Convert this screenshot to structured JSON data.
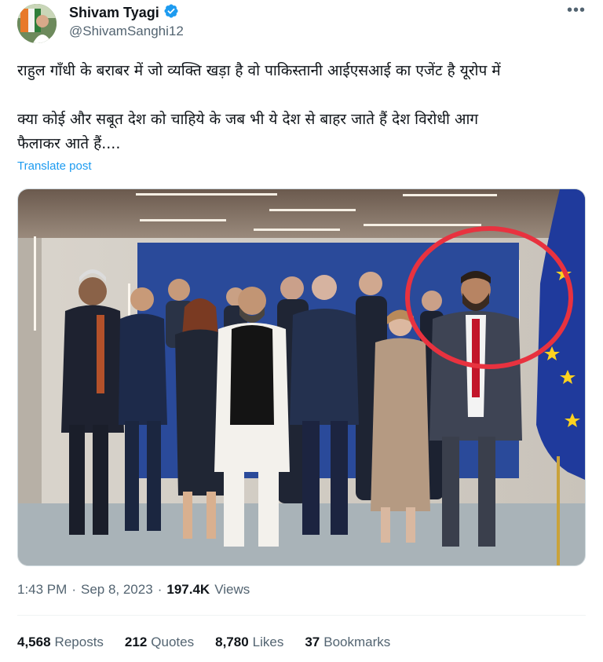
{
  "author": {
    "display_name": "Shivam Tyagi",
    "handle": "@ShivamSanghi12",
    "verified_icon": "verified-badge-icon"
  },
  "post": {
    "line1": "राहुल गाँधी के बराबर में जो व्यक्ति खड़ा है वो पाकिस्तानी आईएसआई का एजेंट है यूरोप में",
    "line2": "क्या कोई और सबूत देश को चाहिये के जब भी ये देश से बाहर जाते हैं देश विरोधी आग",
    "line3": "फैलाकर आते हैं....",
    "translate_label": "Translate post"
  },
  "meta": {
    "time": "1:43 PM",
    "sep1": "·",
    "date": "Sep 8, 2023",
    "sep2": "·",
    "views_count": "197.4K",
    "views_label": "Views"
  },
  "stats": {
    "reposts_count": "4,568",
    "reposts_label": "Reposts",
    "quotes_count": "212",
    "quotes_label": "Quotes",
    "likes_count": "8,780",
    "likes_label": "Likes",
    "bookmarks_count": "37",
    "bookmarks_label": "Bookmarks"
  },
  "colors": {
    "link": "#1d9bf0",
    "secondary_text": "#536471",
    "highlight_circle": "#e8323f",
    "backdrop": "#2a4a9a",
    "eu_flag": "#1f3a9c"
  }
}
